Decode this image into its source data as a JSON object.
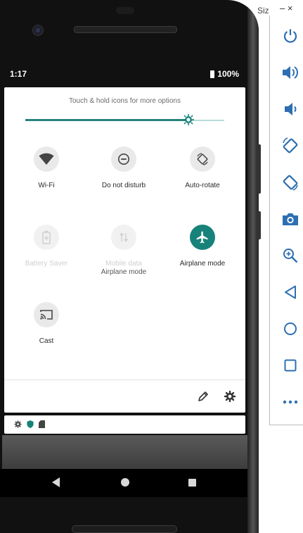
{
  "status_bar": {
    "time": "1:17",
    "battery": "100%"
  },
  "quick_settings": {
    "hint": "Touch & hold icons for more options",
    "brightness": 0.82,
    "tiles": [
      {
        "label": "Wi-Fi",
        "icon": "wifi-icon",
        "state": "inactive"
      },
      {
        "label": "Do not disturb",
        "icon": "do-not-disturb-icon",
        "state": "inactive"
      },
      {
        "label": "Auto-rotate",
        "icon": "auto-rotate-icon",
        "state": "inactive"
      },
      {
        "label": "Battery Saver",
        "icon": "battery-saver-icon",
        "state": "disabled"
      },
      {
        "label": "Mobile data",
        "sublabel": "Airplane mode",
        "icon": "mobile-data-icon",
        "state": "disabled"
      },
      {
        "label": "Airplane mode",
        "icon": "airplane-icon",
        "state": "active"
      },
      {
        "label": "Cast",
        "icon": "cast-icon",
        "state": "inactive"
      }
    ]
  },
  "colors": {
    "accent": "#17827a",
    "tile_bg": "#e9e9e9"
  },
  "emulator": {
    "title": "Siz",
    "window_controls": "– ×",
    "tools": [
      "power-icon",
      "volume-up-icon",
      "volume-down-icon",
      "rotate-left-icon",
      "rotate-right-icon",
      "camera-icon",
      "zoom-icon",
      "back-icon",
      "home-icon",
      "overview-icon",
      "more-icon"
    ]
  }
}
